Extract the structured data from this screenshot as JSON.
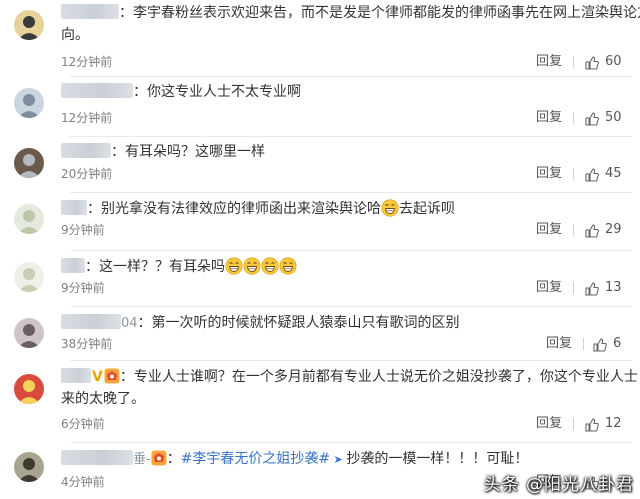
{
  "comments": [
    {
      "user_suffix": "",
      "text": "李宇春粉丝表示欢迎来告，而不是发是个律师都能发的律师函事先在网上渲染舆论方",
      "text2": "向。",
      "time": "12分钟前",
      "reply": "回复",
      "likes": "60"
    },
    {
      "user_suffix": "",
      "text": "你这专业人士不太专业啊",
      "time": "12分钟前",
      "reply": "回复",
      "likes": "50"
    },
    {
      "user_suffix": "",
      "text": "有耳朵吗？这哪里一样",
      "time": "20分钟前",
      "reply": "回复",
      "likes": "45"
    },
    {
      "user_suffix": "",
      "text": "别光拿没有法律效应的律师函出来渲染舆论哈",
      "text_after": "去起诉呗",
      "time": "9分钟前",
      "reply": "回复",
      "likes": "29"
    },
    {
      "user_suffix": "",
      "text": "这一样？？有耳朵吗",
      "time": "9分钟前",
      "reply": "回复",
      "likes": "13"
    },
    {
      "user_suffix": "04",
      "text": "第一次听的时候就怀疑跟人猿泰山只有歌词的区别",
      "time": "38分钟前",
      "reply": "回复",
      "likes": "6"
    },
    {
      "user_suffix": "",
      "text": "专业人士谁啊？在一个多月前都有专业人士说无价之姐没抄袭了，你这个专业人士",
      "text2": "来的太晚了。",
      "time": "6分钟前",
      "reply": "回复",
      "likes": "12"
    },
    {
      "user_suffix": "垂-",
      "tag": "#李宇春无价之姐抄袭#",
      "text": "抄袭的一模一样！！！可耻！",
      "time": "4分钟前",
      "reply": "回复",
      "likes": ""
    }
  ],
  "colors": {
    "link": "#3873c8",
    "text": "#333333",
    "meta": "#808080"
  },
  "icons": {
    "like": "thumbs-up-icon",
    "emoji": "grin-emoji-icon",
    "badge": "super-topic-badge-icon"
  },
  "watermark": "头条 @阳光八卦君"
}
